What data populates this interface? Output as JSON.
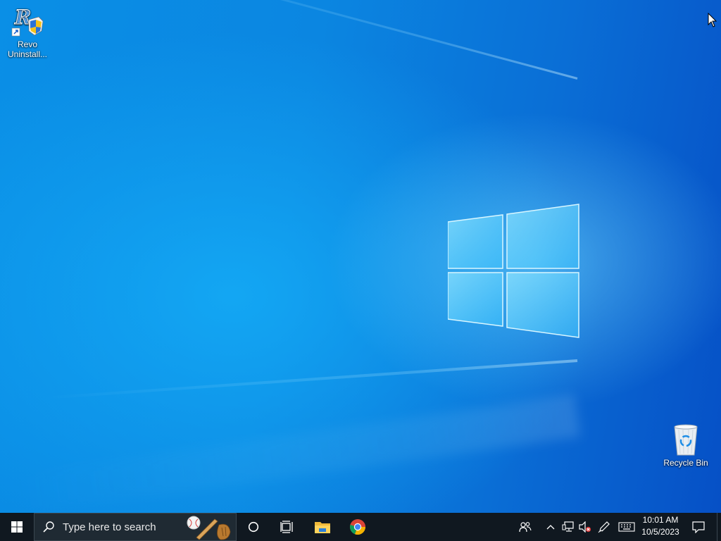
{
  "desktop": {
    "icons": [
      {
        "label": "Revo Uninstall..."
      },
      {
        "label": "Recycle Bin"
      }
    ]
  },
  "taskbar": {
    "search_placeholder": "Type here to search",
    "clock": {
      "time": "10:01 AM",
      "date": "10/5/2023"
    },
    "icons": [
      "windows-start-icon",
      "search-icon",
      "cortana-icon",
      "task-view-icon",
      "file-explorer-icon",
      "chrome-icon",
      "people-icon",
      "chevron-up-icon",
      "network-icon",
      "volume-muted-icon",
      "pen-icon",
      "keyboard-icon",
      "notification-icon"
    ]
  },
  "colors": {
    "taskbar_bg": "#101820",
    "desktop_accent": "#0a8fe6"
  }
}
